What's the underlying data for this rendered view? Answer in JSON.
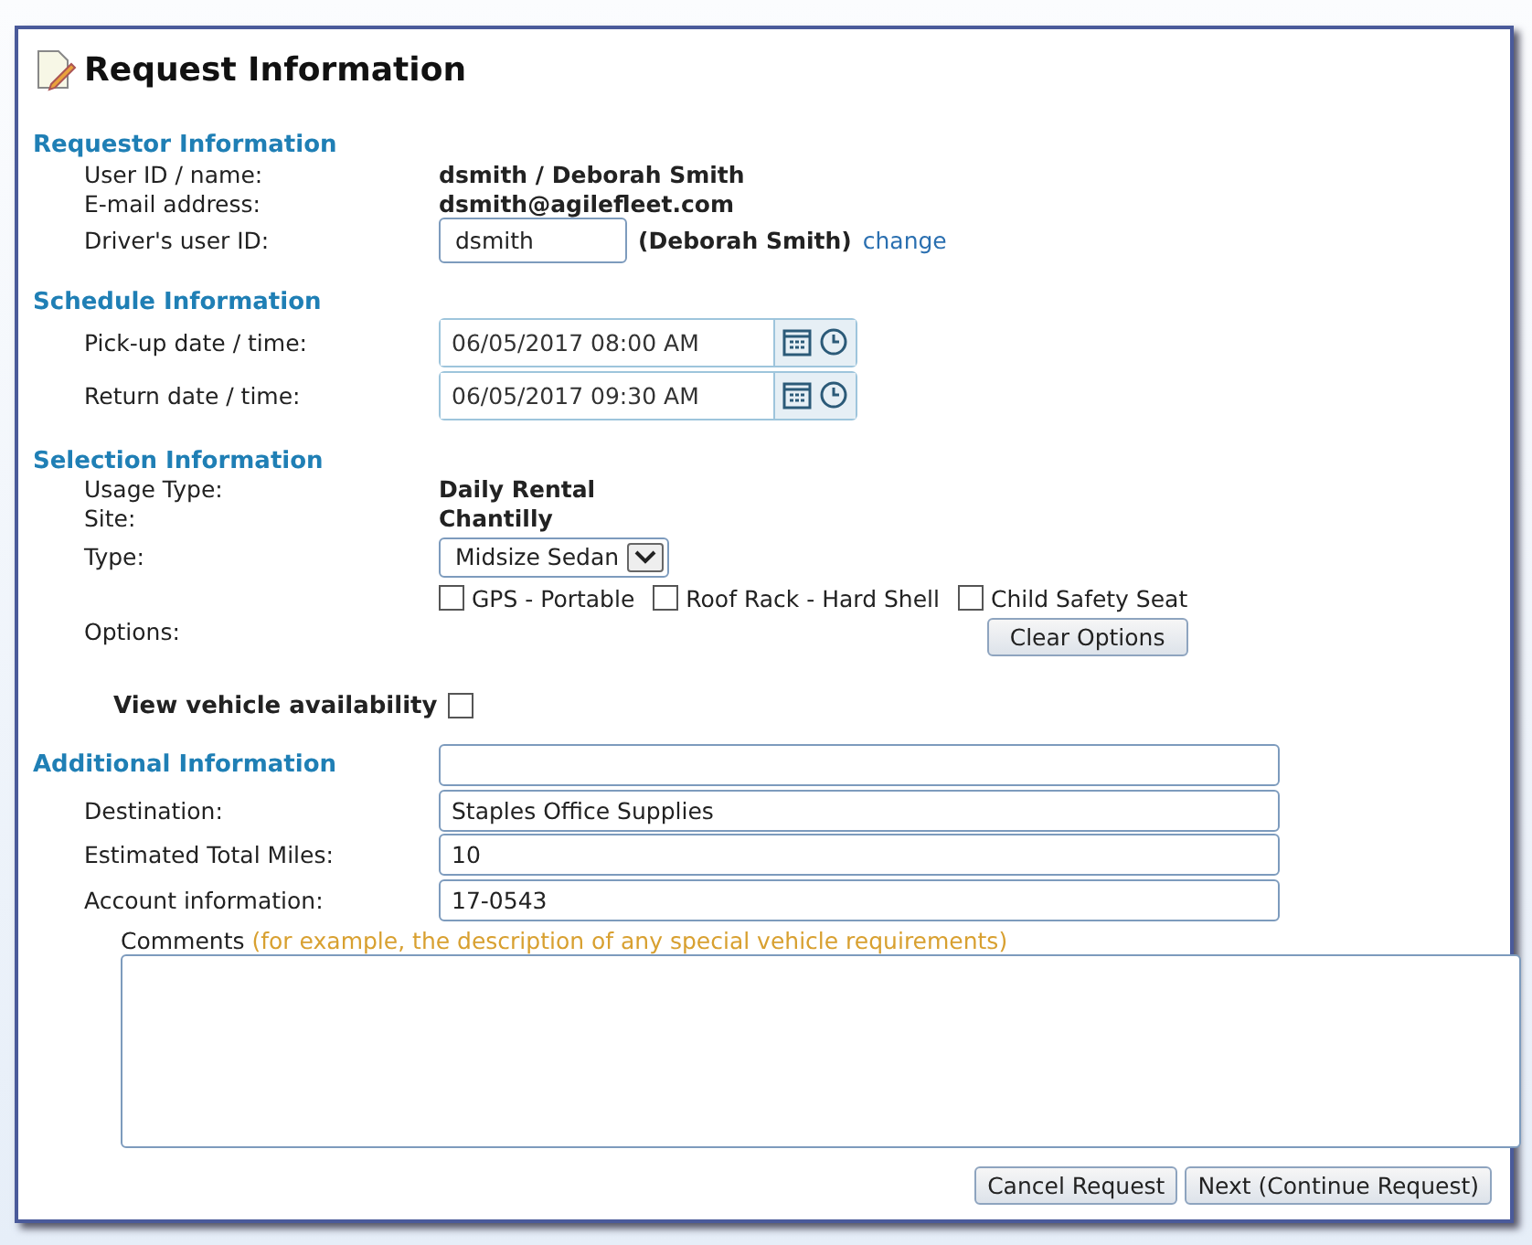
{
  "title": "Request Information",
  "requestor": {
    "heading": "Requestor Information",
    "rows": [
      {
        "label": "User ID / name:",
        "value": "dsmith / Deborah Smith"
      },
      {
        "label": "E-mail address:",
        "value": "dsmith@agilefleet.com"
      }
    ],
    "driver": {
      "label": "Driver's user ID:",
      "value": "dsmith",
      "name": "(Deborah Smith)",
      "link": "change"
    }
  },
  "schedule": {
    "heading": "Schedule Information",
    "rows": [
      {
        "label": "Pick-up date / time:",
        "value": "06/05/2017 08:00 AM"
      },
      {
        "label": "Return date / time:",
        "value": "06/05/2017 09:30 AM"
      }
    ]
  },
  "selection": {
    "heading": "Selection Information",
    "rows": [
      {
        "label": "Usage Type:",
        "value": "Daily Rental"
      },
      {
        "label": "Site:",
        "value": "Chantilly"
      }
    ],
    "type": {
      "label": "Type:",
      "value": "Midsize Sedan"
    },
    "options_label": "Options:",
    "options": [
      {
        "label": "GPS - Portable",
        "checked": false
      },
      {
        "label": "Roof Rack - Hard Shell",
        "checked": false
      },
      {
        "label": "Child Safety Seat",
        "checked": false
      }
    ],
    "clear_button": "Clear Options"
  },
  "availability": {
    "label": "View vehicle availability",
    "checked": false
  },
  "additional": {
    "heading": "Additional Information",
    "rows": [
      {
        "label": "Destination:",
        "value": "Staples Office Supplies"
      },
      {
        "label": "Estimated Total Miles:",
        "value": "10"
      },
      {
        "label": "Account information:",
        "value": "17-0543"
      }
    ],
    "comments_label": "Comments",
    "comments_hint": "(for example, the description of any special vehicle requirements)"
  },
  "buttons": [
    "Cancel Request",
    "Next (Continue Request)"
  ]
}
